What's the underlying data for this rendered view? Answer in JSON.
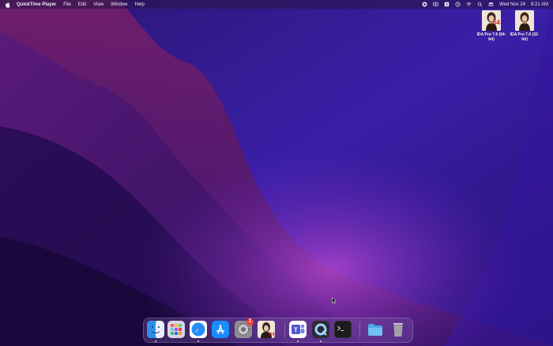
{
  "colors": {
    "wallpaper_dark": "#1f0f55",
    "wallpaper_magenta": "#8b1f6a",
    "wallpaper_purple": "#4b1fb0",
    "dock_bg": "#7a5aaa",
    "badge": "#ff3b30"
  },
  "menubar": {
    "apple_icon": "apple-logo",
    "app_name": "QuickTime Player",
    "items": [
      "File",
      "Edit",
      "View",
      "Window",
      "Help"
    ],
    "status_icons": [
      "record-icon",
      "screen-record-icon",
      "keyboard-icon",
      "control-icon",
      "wifi-icon",
      "search-icon",
      "control-center-icon"
    ],
    "date": "Wed Nov 24",
    "time": "8:21 AM"
  },
  "desktop_icons": [
    {
      "label": "IDA Pro 7.6 (64-bit)",
      "overlay": "64"
    },
    {
      "label": "IDA Pro 7.6 (32-bit)",
      "overlay": ""
    }
  ],
  "dock": {
    "items": [
      {
        "name": "Finder",
        "icon": "finder-icon",
        "running": true
      },
      {
        "name": "Launchpad",
        "icon": "launchpad-icon",
        "running": false
      },
      {
        "name": "Safari",
        "icon": "safari-icon",
        "running": true
      },
      {
        "name": "App Store",
        "icon": "app-store-icon",
        "running": false
      },
      {
        "name": "System Preferences",
        "icon": "gear-icon",
        "running": false,
        "badge": "1"
      },
      {
        "name": "IDA Pro",
        "icon": "ida-icon",
        "running": false
      },
      {
        "name": "Microsoft Teams",
        "icon": "teams-icon",
        "running": true
      },
      {
        "name": "QuickTime Player",
        "icon": "quicktime-icon",
        "running": true
      },
      {
        "name": "Terminal",
        "icon": "terminal-icon",
        "running": false
      },
      {
        "name": "Downloads",
        "icon": "folder-icon",
        "running": false
      },
      {
        "name": "Trash",
        "icon": "trash-icon",
        "running": false
      }
    ]
  }
}
